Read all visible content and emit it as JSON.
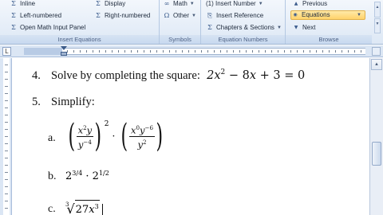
{
  "ribbon": {
    "insert_equations": {
      "label": "Insert Equations",
      "items": [
        {
          "icon": "sigma-icon",
          "glyph": "Σ",
          "label": "Inline"
        },
        {
          "icon": "sigma-icon",
          "glyph": "Σ",
          "label": "Left-numbered"
        },
        {
          "icon": "sigma-icon",
          "glyph": "Σ",
          "label": "Open Math Input Panel"
        },
        {
          "icon": "sigma-icon",
          "glyph": "Σ",
          "label": "Display"
        },
        {
          "icon": "sigma-icon",
          "glyph": "Σ",
          "label": "Right-numbered"
        }
      ]
    },
    "symbols": {
      "label": "Symbols",
      "items": [
        {
          "icon": "infinity-icon",
          "glyph": "∞",
          "label": "Math"
        },
        {
          "icon": "omega-icon",
          "glyph": "Ω",
          "label": "Other"
        }
      ]
    },
    "equation_numbers": {
      "label": "Equation Numbers",
      "items": [
        {
          "icon": "insert-number-icon",
          "glyph": "",
          "label": "(1) Insert Number"
        },
        {
          "icon": "insert-reference-icon",
          "glyph": "⎘",
          "label": "Insert Reference"
        },
        {
          "icon": "chapters-sections-icon",
          "glyph": "Σ",
          "label": "Chapters & Sections"
        }
      ]
    },
    "browse": {
      "label": "Browse",
      "items": [
        {
          "icon": "previous-icon",
          "glyph": "▲",
          "label": "Previous"
        },
        {
          "icon": "equations-icon",
          "glyph": "◉",
          "label": "Equations"
        },
        {
          "icon": "next-icon",
          "glyph": "▼",
          "label": "Next"
        }
      ]
    }
  },
  "document": {
    "q4": {
      "number": "4.",
      "text": "Solve by completing the square:"
    },
    "q5": {
      "number": "5.",
      "text": "Simplify:"
    },
    "parts": {
      "a": "a.",
      "b": "b.",
      "c": "c."
    }
  }
}
